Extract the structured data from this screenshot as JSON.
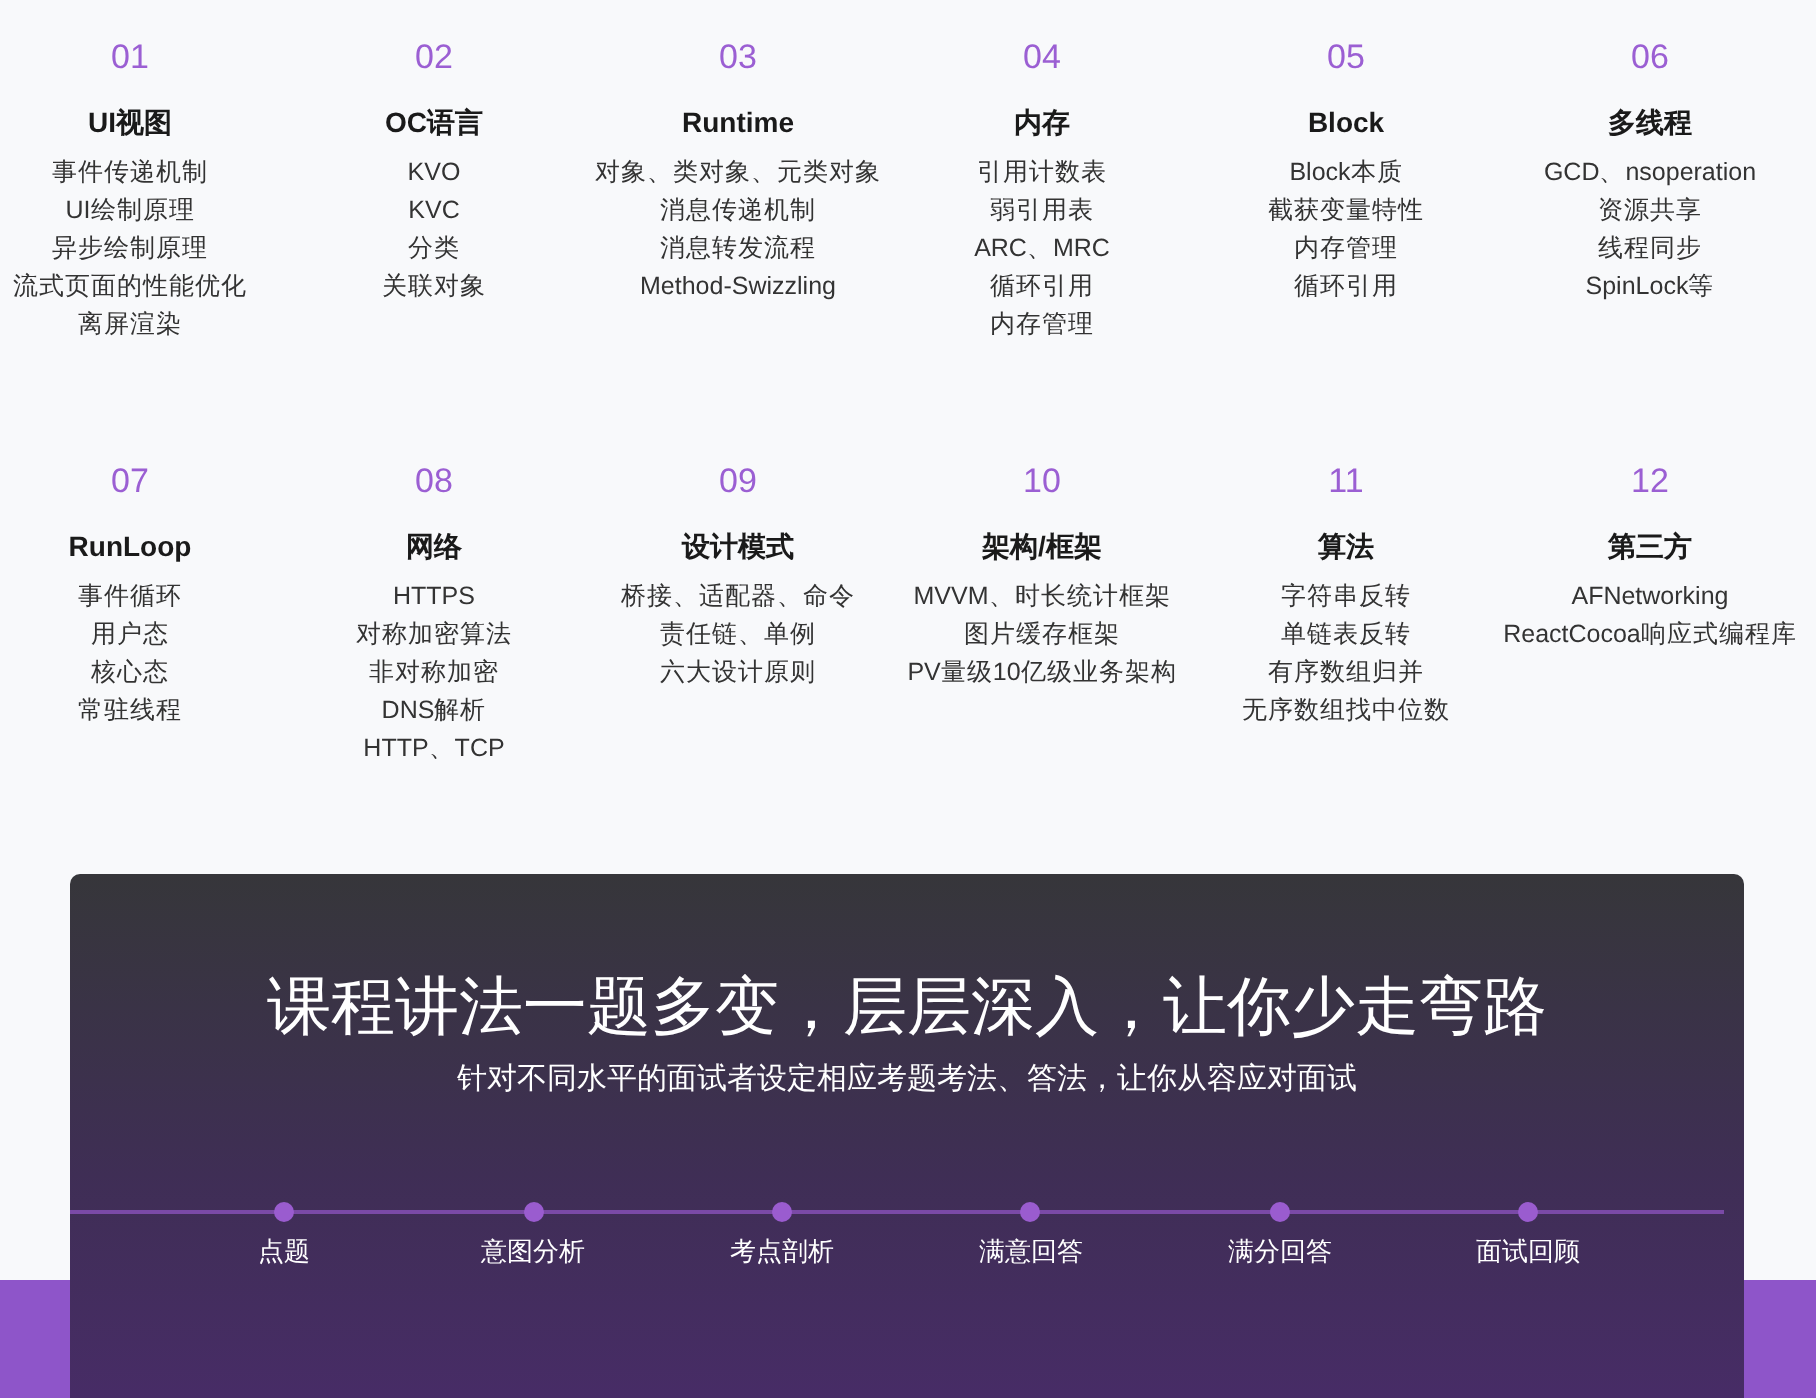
{
  "topics": [
    {
      "number": "01",
      "title": "UI视图",
      "items": [
        "事件传递机制",
        "UI绘制原理",
        "异步绘制原理",
        "流式页面的性能优化",
        "离屏渲染"
      ]
    },
    {
      "number": "02",
      "title": "OC语言",
      "items": [
        "KVO",
        "KVC",
        "分类",
        "关联对象"
      ]
    },
    {
      "number": "03",
      "title": "Runtime",
      "items": [
        "对象、类对象、元类对象",
        "消息传递机制",
        "消息转发流程",
        "Method-Swizzling"
      ]
    },
    {
      "number": "04",
      "title": "内存",
      "items": [
        "引用计数表",
        "弱引用表",
        "ARC、MRC",
        "循环引用",
        "内存管理"
      ]
    },
    {
      "number": "05",
      "title": "Block",
      "items": [
        "Block本质",
        "截获变量特性",
        "内存管理",
        "循环引用"
      ]
    },
    {
      "number": "06",
      "title": "多线程",
      "items": [
        "GCD、nsoperation",
        "资源共享",
        "线程同步",
        "SpinLock等"
      ]
    },
    {
      "number": "07",
      "title": "RunLoop",
      "items": [
        "事件循环",
        "用户态",
        "核心态",
        "常驻线程"
      ]
    },
    {
      "number": "08",
      "title": "网络",
      "items": [
        "HTTPS",
        "对称加密算法",
        "非对称加密",
        "DNS解析",
        "HTTP、TCP"
      ]
    },
    {
      "number": "09",
      "title": "设计模式",
      "items": [
        "桥接、适配器、命令",
        "责任链、单例",
        "六大设计原则"
      ]
    },
    {
      "number": "10",
      "title": "架构/框架",
      "items": [
        "MVVM、时长统计框架",
        "图片缓存框架",
        "PV量级10亿级业务架构"
      ]
    },
    {
      "number": "11",
      "title": "算法",
      "items": [
        "字符串反转",
        "单链表反转",
        "有序数组归并",
        "无序数组找中位数"
      ]
    },
    {
      "number": "12",
      "title": "第三方",
      "items": [
        "AFNetworking",
        "ReactCocoa响应式编程库"
      ]
    }
  ],
  "banner": {
    "title": "课程讲法一题多变，层层深入，让你少走弯路",
    "subtitle": "针对不同水平的面试者设定相应考题考法、答法，让你从容应对面试",
    "steps": [
      "点题",
      "意图分析",
      "考点剖析",
      "满意回答",
      "满分回答",
      "面试回顾"
    ]
  }
}
